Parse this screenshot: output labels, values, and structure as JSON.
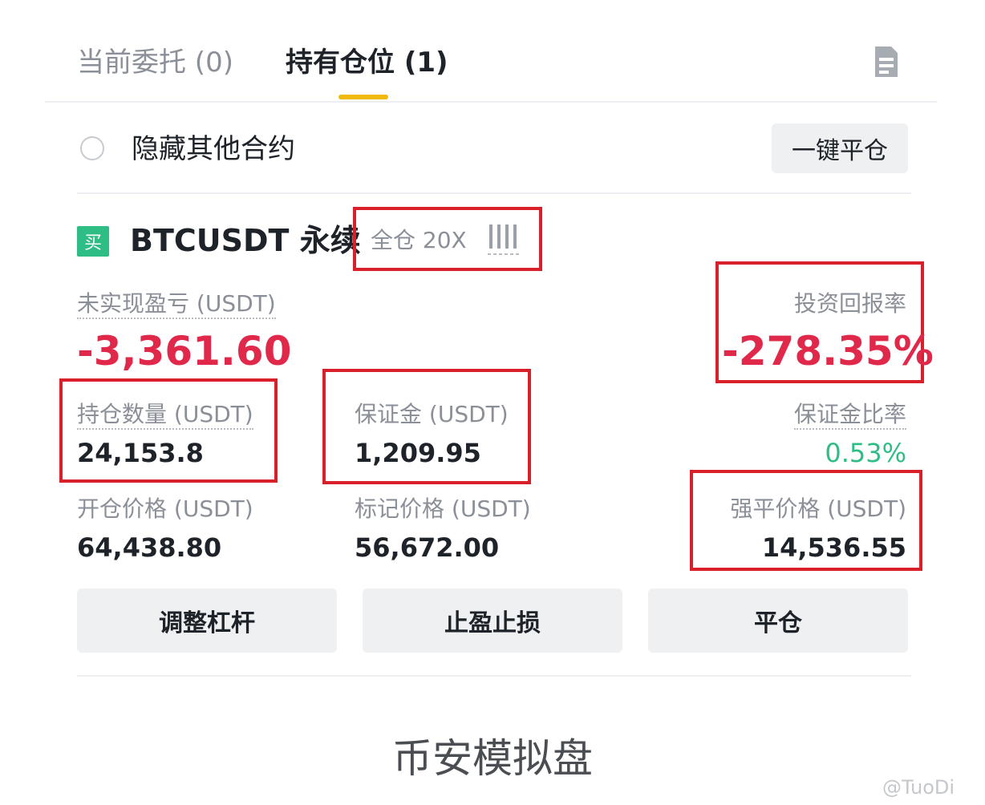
{
  "tabs": {
    "open_orders": "当前委托 (0)",
    "positions": "持有仓位 (1)"
  },
  "hide_other": {
    "label": "隐藏其他合约"
  },
  "close_all_label": "一键平仓",
  "position": {
    "side_badge": "买",
    "symbol": "BTCUSDT 永续",
    "margin_mode": "全仓 20X",
    "unrealized_pnl_label": "未实现盈亏 (USDT)",
    "unrealized_pnl_value": "-3,361.60",
    "roe_label": "投资回报率",
    "roe_value": "-278.35%",
    "size_label": "持仓数量 (USDT)",
    "size_value": "24,153.8",
    "margin_label": "保证金 (USDT)",
    "margin_value": "1,209.95",
    "margin_ratio_label": "保证金比率",
    "margin_ratio_value": "0.53%",
    "entry_price_label": "开仓价格 (USDT)",
    "entry_price_value": "64,438.80",
    "mark_price_label": "标记价格 (USDT)",
    "mark_price_value": "56,672.00",
    "liq_price_label": "强平价格 (USDT)",
    "liq_price_value": "14,536.55"
  },
  "actions": {
    "adjust_leverage": "调整杠杆",
    "tp_sl": "止盈止损",
    "close": "平仓"
  },
  "caption": "币安模拟盘",
  "watermark": "@TuoDi",
  "colors": {
    "accent": "#f0b90b",
    "loss": "#e0294a",
    "profit": "#2ebd85",
    "highlight_box": "#d9202a"
  },
  "icons": {
    "document": "document-icon",
    "leverage_bars": "leverage-bars-icon",
    "radio": "radio-unchecked"
  }
}
